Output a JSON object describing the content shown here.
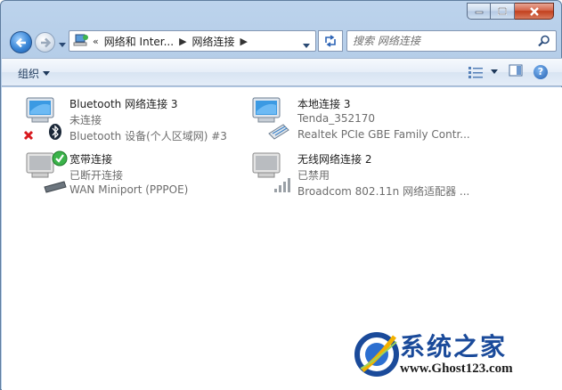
{
  "address": {
    "overflow": "«",
    "crumbs": [
      "网络和 Inter...",
      "网络连接"
    ]
  },
  "search": {
    "placeholder": "搜索 网络连接"
  },
  "toolbar": {
    "organize_label": "组织",
    "help_label": "?"
  },
  "connections": [
    {
      "name": "Bluetooth 网络连接 3",
      "status": "未连接",
      "device": "Bluetooth 设备(个人区域网) #3",
      "icon": "bluetooth-network-icon"
    },
    {
      "name": "本地连接 3",
      "status": "Tenda_352170",
      "device": "Realtek PCIe GBE Family Contr...",
      "icon": "ethernet-network-icon"
    },
    {
      "name": "宽带连接",
      "status": "已断开连接",
      "device": "WAN Miniport (PPPOE)",
      "icon": "broadband-network-icon"
    },
    {
      "name": "无线网络连接 2",
      "status": "已禁用",
      "device": "Broadcom 802.11n 网络适配器 ...",
      "icon": "wireless-network-icon"
    }
  ],
  "watermark": {
    "title": "系统之家",
    "url": "www.Ghost123.com"
  },
  "colors": {
    "accent": "#3a86d6",
    "window_glass": "#b9d0ea",
    "watermark_blue": "#1a4a9a"
  }
}
